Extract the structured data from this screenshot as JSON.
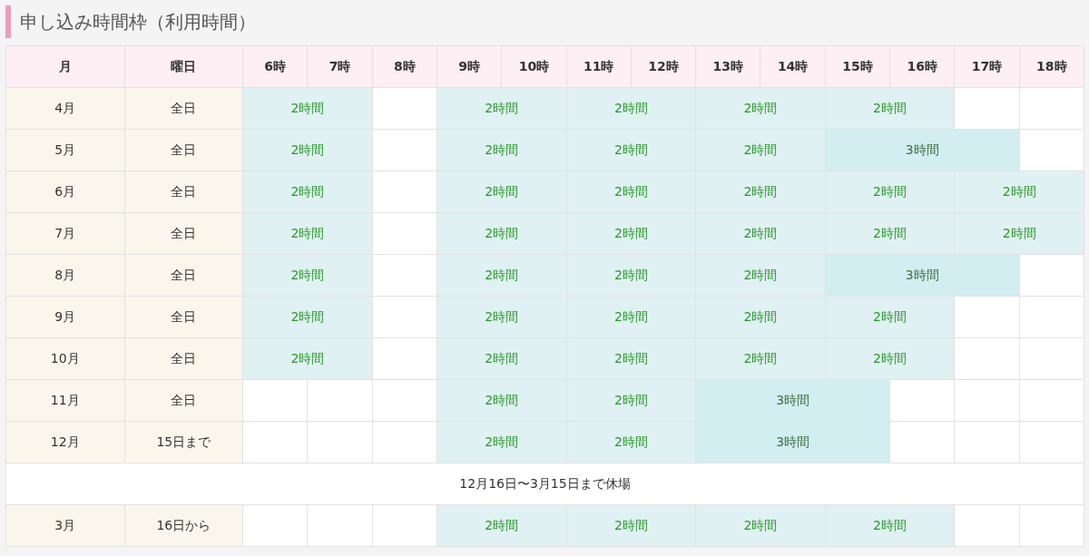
{
  "title": "申し込み時間枠（利用時間）",
  "columns": [
    "月",
    "曜日",
    "6時",
    "7時",
    "8時",
    "9時",
    "10時",
    "11時",
    "12時",
    "13時",
    "14時",
    "15時",
    "16時",
    "17時",
    "18時"
  ],
  "rows": [
    {
      "kind": "month",
      "month": "4月",
      "days": "全日",
      "slots": [
        {
          "kind": "two",
          "text": "2時間"
        },
        {
          "kind": "empty"
        },
        {
          "kind": "two",
          "text": "2時間"
        },
        {
          "kind": "two",
          "text": "2時間"
        },
        {
          "kind": "two",
          "text": "2時間"
        },
        {
          "kind": "two",
          "text": "2時間"
        },
        {
          "kind": "empty"
        },
        {
          "kind": "empty"
        }
      ]
    },
    {
      "kind": "month",
      "month": "5月",
      "days": "全日",
      "slots": [
        {
          "kind": "two",
          "text": "2時間"
        },
        {
          "kind": "empty"
        },
        {
          "kind": "two",
          "text": "2時間"
        },
        {
          "kind": "two",
          "text": "2時間"
        },
        {
          "kind": "two",
          "text": "2時間"
        },
        {
          "kind": "three",
          "text": "3時間"
        },
        {
          "kind": "empty"
        }
      ]
    },
    {
      "kind": "month",
      "month": "6月",
      "days": "全日",
      "slots": [
        {
          "kind": "two",
          "text": "2時間"
        },
        {
          "kind": "empty"
        },
        {
          "kind": "two",
          "text": "2時間"
        },
        {
          "kind": "two",
          "text": "2時間"
        },
        {
          "kind": "two",
          "text": "2時間"
        },
        {
          "kind": "two",
          "text": "2時間"
        },
        {
          "kind": "two",
          "text": "2時間"
        }
      ]
    },
    {
      "kind": "month",
      "month": "7月",
      "days": "全日",
      "slots": [
        {
          "kind": "two",
          "text": "2時間"
        },
        {
          "kind": "empty"
        },
        {
          "kind": "two",
          "text": "2時間"
        },
        {
          "kind": "two",
          "text": "2時間"
        },
        {
          "kind": "two",
          "text": "2時間"
        },
        {
          "kind": "two",
          "text": "2時間"
        },
        {
          "kind": "two",
          "text": "2時間"
        }
      ]
    },
    {
      "kind": "month",
      "month": "8月",
      "days": "全日",
      "slots": [
        {
          "kind": "two",
          "text": "2時間"
        },
        {
          "kind": "empty"
        },
        {
          "kind": "two",
          "text": "2時間"
        },
        {
          "kind": "two",
          "text": "2時間"
        },
        {
          "kind": "two",
          "text": "2時間"
        },
        {
          "kind": "three",
          "text": "3時間"
        },
        {
          "kind": "empty"
        }
      ]
    },
    {
      "kind": "month",
      "month": "9月",
      "days": "全日",
      "slots": [
        {
          "kind": "two",
          "text": "2時間"
        },
        {
          "kind": "empty"
        },
        {
          "kind": "two",
          "text": "2時間"
        },
        {
          "kind": "two",
          "text": "2時間"
        },
        {
          "kind": "two",
          "text": "2時間"
        },
        {
          "kind": "two",
          "text": "2時間"
        },
        {
          "kind": "empty"
        },
        {
          "kind": "empty"
        }
      ]
    },
    {
      "kind": "month",
      "month": "10月",
      "days": "全日",
      "slots": [
        {
          "kind": "two",
          "text": "2時間"
        },
        {
          "kind": "empty"
        },
        {
          "kind": "two",
          "text": "2時間"
        },
        {
          "kind": "two",
          "text": "2時間"
        },
        {
          "kind": "two",
          "text": "2時間"
        },
        {
          "kind": "two",
          "text": "2時間"
        },
        {
          "kind": "empty"
        },
        {
          "kind": "empty"
        }
      ]
    },
    {
      "kind": "month",
      "month": "11月",
      "days": "全日",
      "slots": [
        {
          "kind": "empty"
        },
        {
          "kind": "empty"
        },
        {
          "kind": "empty"
        },
        {
          "kind": "two",
          "text": "2時間"
        },
        {
          "kind": "two",
          "text": "2時間"
        },
        {
          "kind": "three",
          "text": "3時間"
        },
        {
          "kind": "empty"
        },
        {
          "kind": "empty"
        },
        {
          "kind": "empty"
        }
      ]
    },
    {
      "kind": "month",
      "month": "12月",
      "days": "15日まで",
      "slots": [
        {
          "kind": "empty"
        },
        {
          "kind": "empty"
        },
        {
          "kind": "empty"
        },
        {
          "kind": "two",
          "text": "2時間"
        },
        {
          "kind": "two",
          "text": "2時間"
        },
        {
          "kind": "three",
          "text": "3時間"
        },
        {
          "kind": "empty"
        },
        {
          "kind": "empty"
        },
        {
          "kind": "empty"
        }
      ]
    },
    {
      "kind": "closed",
      "text": "12月16日〜3月15日まで休場"
    },
    {
      "kind": "month",
      "month": "3月",
      "days": "16日から",
      "slots": [
        {
          "kind": "empty"
        },
        {
          "kind": "empty"
        },
        {
          "kind": "empty"
        },
        {
          "kind": "two",
          "text": "2時間"
        },
        {
          "kind": "two",
          "text": "2時間"
        },
        {
          "kind": "two",
          "text": "2時間"
        },
        {
          "kind": "two",
          "text": "2時間"
        },
        {
          "kind": "empty"
        },
        {
          "kind": "empty"
        }
      ]
    }
  ]
}
